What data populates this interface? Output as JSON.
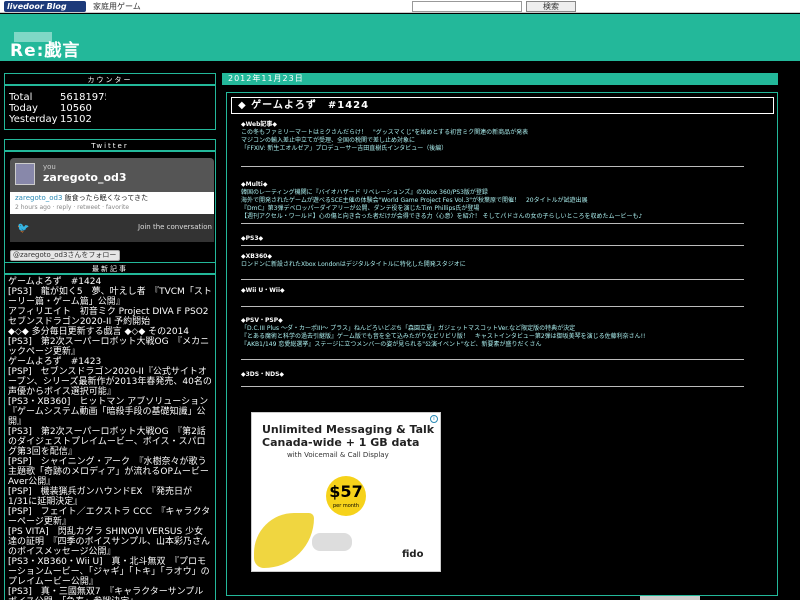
{
  "topbar": {
    "logo": "livedoor Blog",
    "category": "家庭用ゲーム",
    "search_label": "検索"
  },
  "header": {
    "title": "Re:戯言"
  },
  "counter": {
    "heading": "カウンター",
    "rows": [
      {
        "k": "Total",
        "v": "56181975"
      },
      {
        "k": "Today",
        "v": "10560"
      },
      {
        "k": "Yesterday",
        "v": "15102"
      }
    ]
  },
  "twitter": {
    "heading": "Twitter",
    "you": "you",
    "user": "zaregoto_od3",
    "tweet_user": "zaregoto_od3",
    "tweet_text": "飯食ったら眠くなってきた",
    "tweet_meta": "2 hours ago · reply · retweet · favorite",
    "join": "Join the conversation",
    "follow": "@zaregoto_od3さんをフォロー"
  },
  "recent": {
    "heading": "最新記事",
    "items": [
      "ゲームよろず　#1424",
      "[PS3]　龍が如く5　夢、叶えし者　『TVCM「ストーリー篇・ゲーム篇」公開』",
      "アフィリエイト　初音ミク Project DIVA F PSO2 セブンスドラゴン2020-II 予約開始",
      "◆◇◆ 多分毎日更新する戯言 ◆◇◆ その2014",
      "[PS3]　第2次スーパーロボット大戦OG　『メカニックページ更新』",
      "ゲームよろず　#1423",
      "[PSP]　セブンスドラゴン2020-II『公式サイトオープン、シリーズ最新作が2013年春発売、40名の声優からボイス選択可能』",
      "[PS3・XB360]　ヒットマン アブソリューション　『ゲームシステム動画「暗殺手段の基礎知識」公開』",
      "[PS3]　第2次スーパーロボット大戦OG　『第2話のダイジェストプレイムービー、ボイス・スパログ第3回を配信』",
      "[PSP]　シャイニング・アーク　『水樹奈々が歌う主題歌「奇跡のメロディア」が流れるOPムービーAver公開』",
      "[PSP]　機装猟兵ガンハウンドEX　『発売日が1/31に延期決定』",
      "[PSP]　フェイト／エクストラ CCC　『キャラクターページ更新』",
      "[PS VITA]　閃乱カグラ SHINOVI VERSUS 少女達の証明　『四季のボイスサンプル、山本彩乃さんのボイスメッセージ公開』",
      "[PS3・XB360・Wii U]　真・北斗無双　『プロモーションムービー、「ジャギ」「トキ」「ラオウ」のプレイムービー公開』",
      "[PS3]　真・三國無双7　『キャラクターサンプルボイス公開、「急泰」参戦決定』"
    ]
  },
  "main": {
    "date": "2012年11月23日",
    "entry_title": "◆ ゲームよろず　#1424",
    "sections": [
      {
        "head": "◆Web記事◆",
        "lines": [
          "この冬もファミリーマートはミクさんだらけ！　\"グッスマくじ\"を始めとする初音ミク関連の新商品が発表",
          "マジコンの輸入差止申立てが受理、全国の税関で差し止め対象に",
          "「FFXIV: 新生エオルゼア」プロデューサー吉田直樹氏インタビュー（後編）"
        ]
      },
      {
        "head": "◆Multi◆",
        "lines": [
          "韓国のレーティング機関に『バイオハザード リベレーションズ』のXbox 360/PS3版が登録",
          "海外で開発されたゲームが遊べるSCE主催の体験会\"World Game Project Fes Vol.3\"が秋葉原で開催！　20タイトルが試遊出展",
          "『DmC』第3弾デベロッパーダイアリーが公開、ダンテ役を演じたTim Phillips氏が登場",
          "【週刊アクセル・ワールド】心の傷と向き合った者だけが会得できる力〈心意〉を紹介！ そしてパドさんの女の子らしいところを収めたムービーも♪"
        ]
      },
      {
        "head": "◆PS3◆",
        "lines": []
      },
      {
        "head": "◆XB360◆",
        "lines": [
          "ロンドンに新設されたXbox Londonはデジタルタイトルに特化した開発スタジオに"
        ]
      },
      {
        "head": "◆Wii U・Wii◆",
        "lines": []
      },
      {
        "head": "◆PSV・PSP◆",
        "lines": [
          "「D.C.III Plus ～ダ・カーポIII～ プラス」ねんどろいどぷち「森園立夏」ガジェットマスコットVer.など限定版の特典が決定",
          "『とある魔術と科学の過去引継版』ゲーム版でも音を全て込みたがりなビリビリ版！　キャストインタビュー第2弾は御坂美琴を演じる佐藤利奈さん!!",
          "『AKB1/149 恋愛総選挙』ステージに立つメンバーの姿が見られる\"公演イベント\"など、新要素が盛りだくさん"
        ]
      },
      {
        "head": "◆3DS・NDS◆",
        "lines": []
      }
    ],
    "ad": {
      "line1": "Unlimited Messaging & Talk",
      "line2": "Canada-wide + 1 GB data",
      "sub": "with Voicemail & Call Display",
      "price": "$57",
      "per": "per month",
      "brand": "fido"
    }
  },
  "colors": {
    "accent": "#23b89a",
    "background": "#000000",
    "text": "#ffffff"
  }
}
